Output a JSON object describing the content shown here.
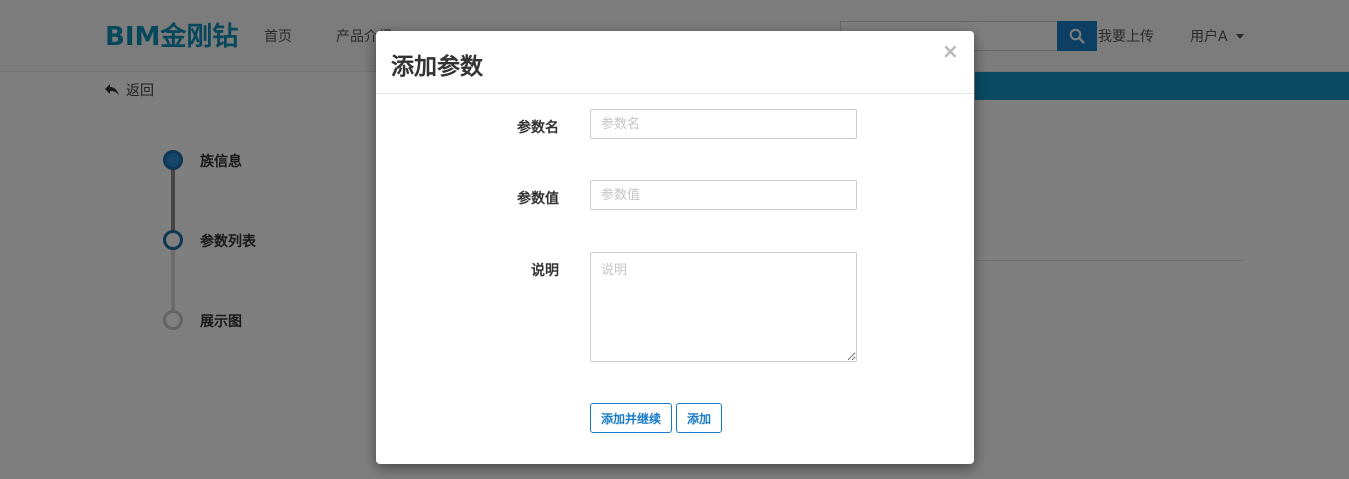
{
  "navbar": {
    "brand": "BIM金刚钻",
    "links": [
      "首页",
      "产品介绍",
      "",
      ""
    ],
    "search": {
      "placeholder": "",
      "icon": "search-icon"
    },
    "upload": "我要上传",
    "user": "用户A"
  },
  "back": {
    "label": "返回",
    "icon": "reply-arrow-icon"
  },
  "steps": [
    {
      "label": "族信息",
      "state": "active"
    },
    {
      "label": "参数列表",
      "state": "current"
    },
    {
      "label": "展示图",
      "state": "pending"
    }
  ],
  "colors": {
    "brand": "#0f8fb8",
    "primary": "#1a7cc8",
    "step_active": "#1a6fa8",
    "step_pending": "#c8c8c8"
  },
  "modal": {
    "title": "添加参数",
    "close": "×",
    "fields": {
      "name": {
        "label": "参数名",
        "placeholder": "参数名",
        "value": ""
      },
      "value": {
        "label": "参数值",
        "placeholder": "参数值",
        "value": ""
      },
      "desc": {
        "label": "说明",
        "placeholder": "说明",
        "value": ""
      }
    },
    "buttons": {
      "add_continue": "添加并继续",
      "add": "添加"
    }
  }
}
